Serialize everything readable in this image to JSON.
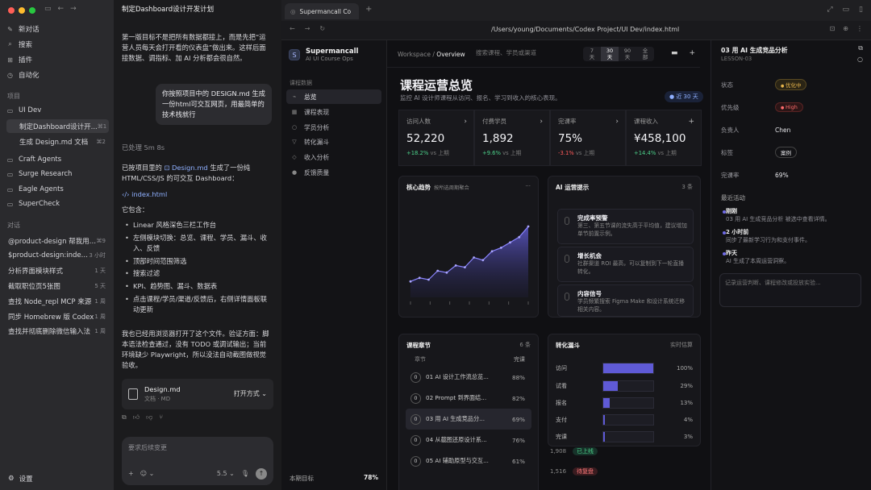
{
  "left_sidebar": {
    "nav": [
      "新对话",
      "搜索",
      "插件",
      "自动化"
    ],
    "projects_label": "项目",
    "project_name": "UI Dev",
    "project_threads": [
      {
        "title": "制定Dashboard设计开...",
        "kbd": "⌘1"
      },
      {
        "title": "生成 Design.md 文档",
        "kbd": "⌘2"
      }
    ],
    "other_projects": [
      "Craft Agents",
      "Surge Research",
      "Eagle Agents",
      "SuperCheck"
    ],
    "chats_label": "对话",
    "chats": [
      {
        "title": "@product-design 帮我用 ...",
        "time": "⌘9"
      },
      {
        "title": "$product-design:index ...",
        "time": "3 小时"
      },
      {
        "title": "分析界面模块样式",
        "time": "1 天"
      },
      {
        "title": "截取职位页5张图",
        "time": "5 天"
      },
      {
        "title": "查找 Node_repl MCP 来源",
        "time": "1 周"
      },
      {
        "title": "同步 Homebrew 版 Codex",
        "time": "1 周"
      },
      {
        "title": "查找并彻底删除微信输入法",
        "time": "1 周"
      }
    ],
    "settings": "设置"
  },
  "chat": {
    "title": "制定Dashboard设计开发计划",
    "intro": "第一版目标不是把所有数据都接上，而是先把“运营人员每天会打开看的仪表盘”做出来。这样后面接数据、调指标、加 AI 分析都会很自然。",
    "user_msg": "你按照项目中的 DESIGN.md 生成一份html可交互网页，用最简单的技术栈就行",
    "processed": "已处理 5m 8s",
    "reply_a": "已按项目里的",
    "reply_link": "Design.md",
    "reply_b": "生成了一份纯 HTML/CSS/JS 的可交互 Dashboard：",
    "file_link": "index.html",
    "contains": "它包含：",
    "bullets": [
      "Linear 风格深色三栏工作台",
      "左侧模块切换：总览、课程、学员、漏斗、收入、反馈",
      "顶部时间范围筛选",
      "搜索过滤",
      "KPI、趋势图、漏斗、数据表",
      "点击课程/学员/渠道/反馈后，右侧详情面板联动更新"
    ],
    "outro": "我也已经用浏览器打开了这个文件。验证方面：脚本语法检查通过，没有 TODO 或调试输出；当前环境缺少 Playwright，所以没法自动截图做视觉验收。",
    "file_name": "Design.md",
    "file_type": "文档 · MD",
    "open_with": "打开方式",
    "composer_placeholder": "要求后续变更",
    "model": "5.5"
  },
  "browser": {
    "tab_title": "Supermancall Co",
    "url": "/Users/young/Documents/Codex Project/UI Dev/index.html"
  },
  "dash": {
    "brand": "Supermancall",
    "brand_sub": "AI UI Course Ops",
    "nav_section": "课程数据",
    "nav": [
      "总览",
      "课程表现",
      "学员分析",
      "转化漏斗",
      "收入分析",
      "反馈质量"
    ],
    "goal_label": "本期目标",
    "goal_value": "78%",
    "crumb_root": "Workspace",
    "crumb_current": "Overview",
    "search_placeholder": "搜索课程、学员或渠道",
    "ranges": [
      {
        "n": "7",
        "u": "天"
      },
      {
        "n": "30",
        "u": "天"
      },
      {
        "n": "90",
        "u": "天"
      },
      {
        "n": "全",
        "u": "部"
      }
    ],
    "page_title": "课程运营总览",
    "page_subtitle": "监控 AI 设计师课程从访问、报名、学习到收入的核心表现。",
    "range_badge": "● 近 30 天",
    "kpis": [
      {
        "label": "访问人数",
        "value": "52,220",
        "delta": "+18.2%",
        "vs": "vs 上期",
        "trend": "up"
      },
      {
        "label": "付费学员",
        "value": "1,892",
        "delta": "+9.6%",
        "vs": "vs 上期",
        "trend": "up"
      },
      {
        "label": "完课率",
        "value": "75%",
        "delta": "-3.1%",
        "vs": "vs 上期",
        "trend": "down"
      },
      {
        "label": "课程收入",
        "value": "¥458,100",
        "delta": "+14.4%",
        "vs": "vs 上期",
        "trend": "up"
      }
    ],
    "trend_title": "核心趋势",
    "trend_sub": "按所选周期聚合",
    "trend_points": [
      18,
      22,
      20,
      30,
      28,
      36,
      34,
      45,
      42,
      52,
      56,
      62,
      68,
      80
    ],
    "tips_title": "AI 运营提示",
    "tips_count": "3 条",
    "tips": [
      {
        "title": "完成率预警",
        "body": "第三、第五节课的流失高于平均值，建议增加单节前置示例。"
      },
      {
        "title": "增长机会",
        "body": "社群渠道 ROI 最高，可以复制到下一轮直播转化。"
      },
      {
        "title": "内容信号",
        "body": "学员频繁搜索 Figma Make 和设计系统迁移相关内容。"
      }
    ],
    "chapters_title": "课程章节",
    "chapters_count": "6 条",
    "chapters_head": {
      "name": "章节",
      "rate": "完课"
    },
    "chapters": [
      {
        "n": "0",
        "name": "01 AI 设计工作流总览...",
        "rate": "88%"
      },
      {
        "n": "0",
        "name": "02 Prompt 到界面结...",
        "rate": "82%"
      },
      {
        "n": "0",
        "name": "03 用 AI 生成竞品分...",
        "rate": "69%"
      },
      {
        "n": "0",
        "name": "04 从截图还原设计系...",
        "rate": "76%"
      },
      {
        "n": "0",
        "name": "05 AI 辅助原型与交互...",
        "rate": "61%"
      }
    ],
    "funnel_title": "转化漏斗",
    "funnel_note": "实时估算",
    "funnel": [
      {
        "label": "访问",
        "pct": 100,
        "text": "100%"
      },
      {
        "label": "试看",
        "pct": 29,
        "text": "29%"
      },
      {
        "label": "报名",
        "pct": 13,
        "text": "13%"
      },
      {
        "label": "支付",
        "pct": 4,
        "text": "4%"
      },
      {
        "label": "完课",
        "pct": 3,
        "text": "3%"
      }
    ],
    "bleed_rows": [
      {
        "num": "1,908",
        "status": "已上线"
      },
      {
        "num": "1,516",
        "status": "待复盘"
      }
    ],
    "detail": {
      "title": "03 用 AI 生成竞品分析",
      "sub": "LESSON-03",
      "props": [
        {
          "k": "状态",
          "v": "优化中",
          "kind": "o"
        },
        {
          "k": "优先级",
          "v": "High",
          "kind": "r"
        },
        {
          "k": "负责人",
          "v": "Chen",
          "kind": "t"
        },
        {
          "k": "标签",
          "v": "案例",
          "kind": "c"
        },
        {
          "k": "完课率",
          "v": "69%",
          "kind": "t"
        }
      ],
      "activity_label": "最近活动",
      "events": [
        {
          "t": "刚刚",
          "d": "03 用 AI 生成竞品分析 被选中查看详情。"
        },
        {
          "t": "2 小时前",
          "d": "同步了最新学习行为和支付事件。"
        },
        {
          "t": "昨天",
          "d": "AI 生成了本周运营洞察。"
        }
      ],
      "note_placeholder": "记录运营判断、课程修改或投放实验..."
    }
  }
}
